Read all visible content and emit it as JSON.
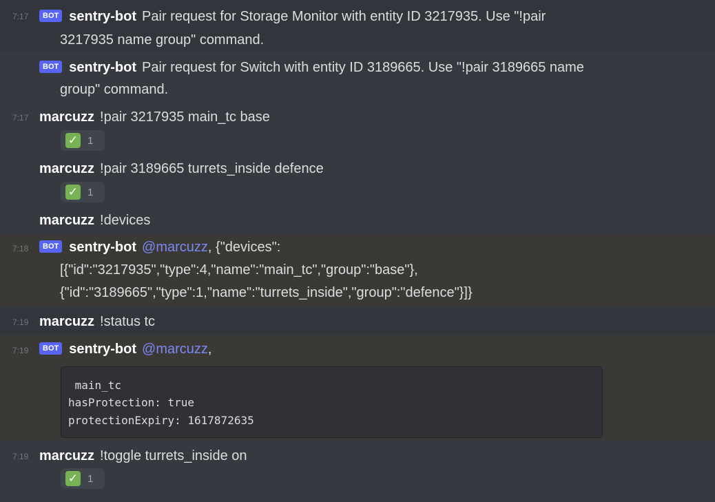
{
  "messages": {
    "m1": {
      "time": "7:17",
      "tag": "BOT",
      "author": "sentry-bot",
      "text1": "Pair request for Storage Monitor with entity ID 3217935. Use \"!pair",
      "text2": "3217935 name group\" command."
    },
    "m2": {
      "tag": "BOT",
      "author": "sentry-bot",
      "text1": "Pair request for Switch with entity ID 3189665. Use \"!pair 3189665 name",
      "text2": "group\" command."
    },
    "m3": {
      "time": "7:17",
      "author": "marcuzz",
      "text": "!pair 3217935 main_tc base",
      "reaction_count": "1"
    },
    "m4": {
      "author": "marcuzz",
      "text": "!pair 3189665 turrets_inside defence",
      "reaction_count": "1"
    },
    "m5": {
      "author": "marcuzz",
      "text": "!devices"
    },
    "m6": {
      "time": "7:18",
      "tag": "BOT",
      "author": "sentry-bot",
      "mention": "@marcuzz",
      "text1": ", {\"devices\":",
      "text2": "[{\"id\":\"3217935\",\"type\":4,\"name\":\"main_tc\",\"group\":\"base\"},",
      "text3": "{\"id\":\"3189665\",\"type\":1,\"name\":\"turrets_inside\",\"group\":\"defence\"}]}"
    },
    "m7": {
      "time": "7:19",
      "author": "marcuzz",
      "text": "!status tc"
    },
    "m8": {
      "time": "7:19",
      "tag": "BOT",
      "author": "sentry-bot",
      "mention": "@marcuzz",
      "after": ",",
      "code1": " main_tc",
      "code2": "hasProtection: true",
      "code3": "protectionExpiry: 1617872635"
    },
    "m9": {
      "time": "7:19",
      "author": "marcuzz",
      "text": "!toggle turrets_inside on",
      "reaction_count": "1"
    }
  },
  "reaction_emoji": "✓",
  "colors": {
    "background": "#36393f",
    "bot_tag": "#5865f2",
    "mention": "#7c88f2",
    "reaction_check": "#77b255"
  }
}
